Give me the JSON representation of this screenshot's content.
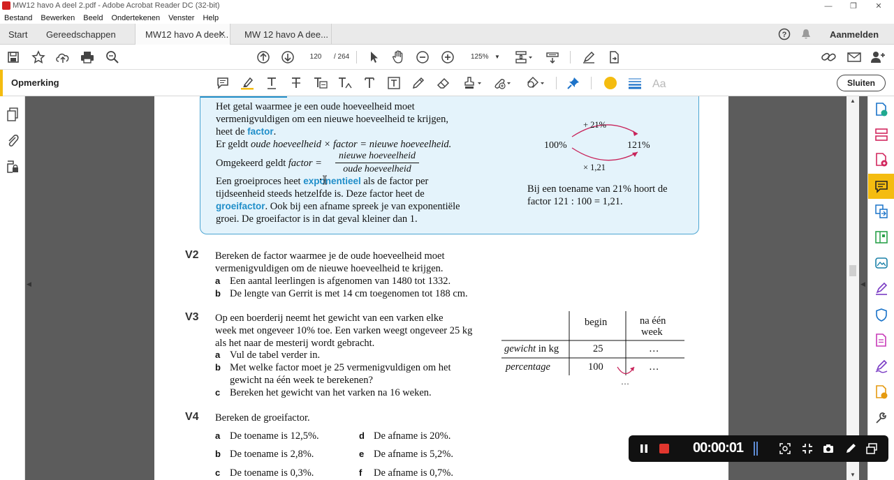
{
  "window": {
    "title": "MW12 havo A deel 2.pdf - Adobe Acrobat Reader DC (32-bit)"
  },
  "menu": [
    "Bestand",
    "Bewerken",
    "Beeld",
    "Ondertekenen",
    "Venster",
    "Help"
  ],
  "tabs": {
    "start": "Start",
    "tools": "Gereedschappen",
    "doc1": "MW12 havo A deel...",
    "doc2": "MW 12 havo A dee...",
    "signin": "Aanmelden"
  },
  "toolbar": {
    "page_current": "120",
    "page_total": "/ 264",
    "zoom": "125%"
  },
  "commentbar": {
    "label": "Opmerking",
    "close": "Sluiten",
    "color": "#f4bc10"
  },
  "theory": {
    "l1": "Het getal waarmee je een oude hoeveelheid moet",
    "l2": "vermenigvuldigen om een nieuwe hoeveelheid te krijgen,",
    "l3_pre": "heet de ",
    "l3_kw": "factor",
    "l3_post": ".",
    "l4_pre": "Er geldt ",
    "l4_it": "oude hoeveelheid × factor = nieuwe hoeveelheid.",
    "l5_pre": "Omgekeerd geldt ",
    "l5_it": "factor =",
    "frac_num": "nieuwe hoeveelheid",
    "frac_den": "oude hoeveelheid",
    "l6_pre": "Een groeiproces heet ",
    "l6_kw": "exponentieel",
    "l6_post": " als de factor per",
    "l7": "tijdseenheid steeds hetzelfde is. Deze factor heet de",
    "l8_kw": "groeifactor",
    "l8_post": ". Ook bij een afname spreek je van exponentiële",
    "l9": "groei. De groeifactor is in dat geval kleiner dan 1.",
    "diagram": {
      "top": "+ 21%",
      "left": "100%",
      "right": "121%",
      "bottom": "× 1,21"
    },
    "note1": "Bij een toename van 21% hoort de",
    "note2": "factor 121 : 100 = 1,21."
  },
  "v2": {
    "num": "V2",
    "l1": "Bereken de factor waarmee je de oude hoeveelheid moet",
    "l2": "vermenigvuldigen om de nieuwe hoeveelheid te krijgen.",
    "a": "Een aantal leerlingen is afgenomen van 1480 tot 1332.",
    "b": "De lengte van Gerrit is met 14 cm toegenomen tot 188 cm."
  },
  "v3": {
    "num": "V3",
    "l1": "Op een boerderij neemt het gewicht van een varken elke",
    "l2": "week met ongeveer 10% toe. Een varken weegt ongeveer 25 kg",
    "l3": "als het naar de mesterij wordt gebracht.",
    "a": "Vul de tabel verder in.",
    "b1": "Met welke factor moet je 25 vermenigvuldigen om het",
    "b2": "gewicht na één week te berekenen?",
    "c": "Bereken het gewicht van het varken na 16 weken.",
    "table": {
      "h_begin": "begin",
      "h_week1": "na één",
      "h_week2": "week",
      "r1_label": "gewicht",
      "r1_unit": " in kg",
      "r1_begin": "25",
      "r1_week": "…",
      "r2_label": "percentage",
      "r2_begin": "100",
      "r2_week": "…",
      "below": "…"
    }
  },
  "v4": {
    "num": "V4",
    "intro": "Bereken de groeifactor.",
    "a": "De toename is 12,5%.",
    "b": "De toename is 2,8%.",
    "c": "De toename is 0,3%.",
    "d": "De afname is 20%.",
    "e": "De afname is 5,2%.",
    "f": "De afname is 0,7%."
  },
  "labels": {
    "a": "a",
    "b": "b",
    "c": "c",
    "d": "d",
    "e": "e",
    "f": "f"
  },
  "recorder": {
    "time": "00:00:01"
  }
}
